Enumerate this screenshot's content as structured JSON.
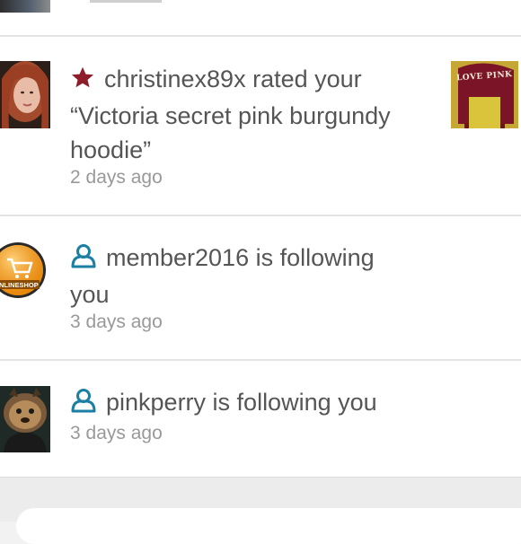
{
  "notifications": [
    {
      "user": "christinex89x",
      "action_line1": "rated your",
      "quote_line1": "“Victoria secret pink burgundy",
      "quote_line2": "hoodie”",
      "time": "2 days ago",
      "icon": "star-icon",
      "thumbnail_text": "LOVE PINK"
    },
    {
      "line1": "member2016 is following",
      "line2": "you",
      "time": "3 days ago",
      "icon": "user-outline-icon",
      "avatar_text": "NLINESHOP"
    },
    {
      "line1": "pinkperry is following you",
      "time": "3 days ago",
      "icon": "user-outline-icon"
    }
  ],
  "colors": {
    "star": "#8e1c2b",
    "follow_icon": "#1a7fa3",
    "text": "#555555",
    "muted": "#999999"
  }
}
